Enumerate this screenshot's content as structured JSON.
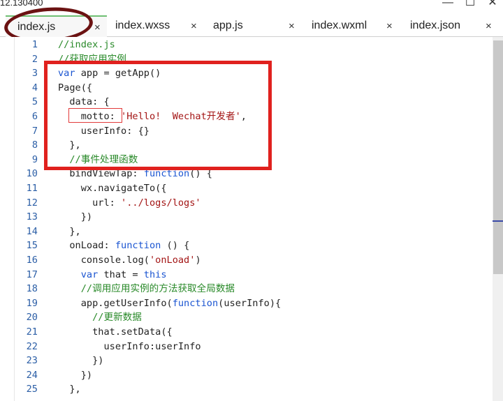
{
  "window": {
    "title": "12.130400",
    "controls": [
      "—",
      "☐",
      "✕"
    ]
  },
  "tabs": [
    {
      "label": "index.js",
      "active": true
    },
    {
      "label": "index.wxss",
      "active": false
    },
    {
      "label": "app.js",
      "active": false
    },
    {
      "label": "index.wxml",
      "active": false
    },
    {
      "label": "index.json",
      "active": false
    }
  ],
  "tab_close_glyph": "×",
  "colors": {
    "keyword": "#1b55d1",
    "string": "#a31515",
    "comment": "#2a8a2a",
    "line_number": "#2b5ea6",
    "highlight_box": "#e0211e",
    "active_tab_ring": "#6b1212",
    "active_tab_accent": "#6fbf73"
  },
  "code_lines": [
    {
      "n": "1",
      "segs": [
        [
          "c",
          "//index.js"
        ]
      ]
    },
    {
      "n": "2",
      "segs": [
        [
          "c",
          "//获取应用实例"
        ]
      ]
    },
    {
      "n": "3",
      "segs": [
        [
          "k",
          "var"
        ],
        [
          "p",
          " app = getApp()"
        ]
      ]
    },
    {
      "n": "4",
      "segs": [
        [
          "p",
          "Page({"
        ]
      ]
    },
    {
      "n": "5",
      "segs": [
        [
          "p",
          "  data: {"
        ]
      ]
    },
    {
      "n": "6",
      "segs": [
        [
          "p",
          "    motto: "
        ],
        [
          "s",
          "'Hello!  Wechat开发者'"
        ],
        [
          "p",
          ","
        ]
      ]
    },
    {
      "n": "7",
      "segs": [
        [
          "p",
          "    userInfo: {}"
        ]
      ]
    },
    {
      "n": "8",
      "segs": [
        [
          "p",
          "  },"
        ]
      ]
    },
    {
      "n": "9",
      "segs": [
        [
          "c",
          "  //事件处理函数"
        ]
      ]
    },
    {
      "n": "10",
      "segs": [
        [
          "p",
          "  bindViewTap: "
        ],
        [
          "k",
          "function"
        ],
        [
          "p",
          "() {"
        ]
      ]
    },
    {
      "n": "11",
      "segs": [
        [
          "p",
          "    wx.navigateTo({"
        ]
      ]
    },
    {
      "n": "12",
      "segs": [
        [
          "p",
          "      url: "
        ],
        [
          "s",
          "'../logs/logs'"
        ]
      ]
    },
    {
      "n": "13",
      "segs": [
        [
          "p",
          "    })"
        ]
      ]
    },
    {
      "n": "14",
      "segs": [
        [
          "p",
          "  },"
        ]
      ]
    },
    {
      "n": "15",
      "segs": [
        [
          "p",
          "  onLoad: "
        ],
        [
          "k",
          "function"
        ],
        [
          "p",
          " () {"
        ]
      ]
    },
    {
      "n": "16",
      "segs": [
        [
          "p",
          "    console.log("
        ],
        [
          "s",
          "'onLoad'"
        ],
        [
          "p",
          ")"
        ]
      ]
    },
    {
      "n": "17",
      "segs": [
        [
          "k",
          "    var"
        ],
        [
          "p",
          " that = "
        ],
        [
          "k",
          "this"
        ]
      ]
    },
    {
      "n": "18",
      "segs": [
        [
          "c",
          "    //调用应用实例的方法获取全局数据"
        ]
      ]
    },
    {
      "n": "19",
      "segs": [
        [
          "p",
          "    app.getUserInfo("
        ],
        [
          "k",
          "function"
        ],
        [
          "p",
          "(userInfo){"
        ]
      ]
    },
    {
      "n": "20",
      "segs": [
        [
          "c",
          "      //更新数据"
        ]
      ]
    },
    {
      "n": "21",
      "segs": [
        [
          "p",
          "      that.setData({"
        ]
      ]
    },
    {
      "n": "22",
      "segs": [
        [
          "p",
          "        userInfo:userInfo"
        ]
      ]
    },
    {
      "n": "23",
      "segs": [
        [
          "p",
          "      })"
        ]
      ]
    },
    {
      "n": "24",
      "segs": [
        [
          "p",
          "    })"
        ]
      ]
    },
    {
      "n": "25",
      "segs": [
        [
          "p",
          "  },"
        ]
      ]
    }
  ]
}
